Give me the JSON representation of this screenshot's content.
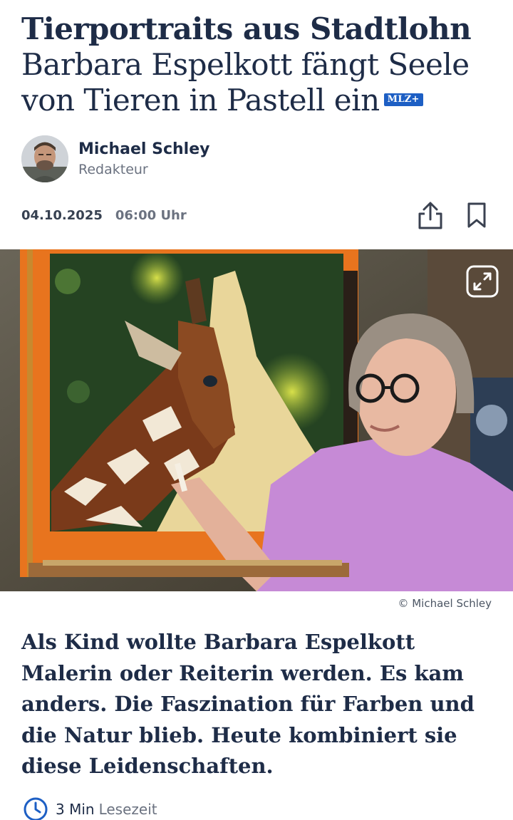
{
  "article": {
    "kicker": "Tierportraits aus Stadtlohn",
    "title": "Barbara Espelkott fängt Seele von Tieren in Pastell ein",
    "plus_badge": "MLZ+",
    "author": {
      "name": "Michael Schley",
      "role": "Redakteur"
    },
    "date": "04.10.2025",
    "time": "06:00 Uhr",
    "image": {
      "credit": "© Michael Schley"
    },
    "lead": "Als Kind wollte Barbara Espelkott Malerin oder Reiterin werden. Es kam anders. Die Faszination für Farben und die Natur blieb. Heute kombiniert sie diese Leidenschaften.",
    "reading_time": {
      "minutes": "3 Min",
      "label": "Lesezeit"
    }
  },
  "icons": {
    "share": "share-icon",
    "bookmark": "bookmark-icon",
    "expand": "expand-icon",
    "clock": "clock-icon"
  },
  "colors": {
    "text_primary": "#1e2c47",
    "text_secondary": "#6b7280",
    "badge_blue": "#1d5fc4"
  }
}
